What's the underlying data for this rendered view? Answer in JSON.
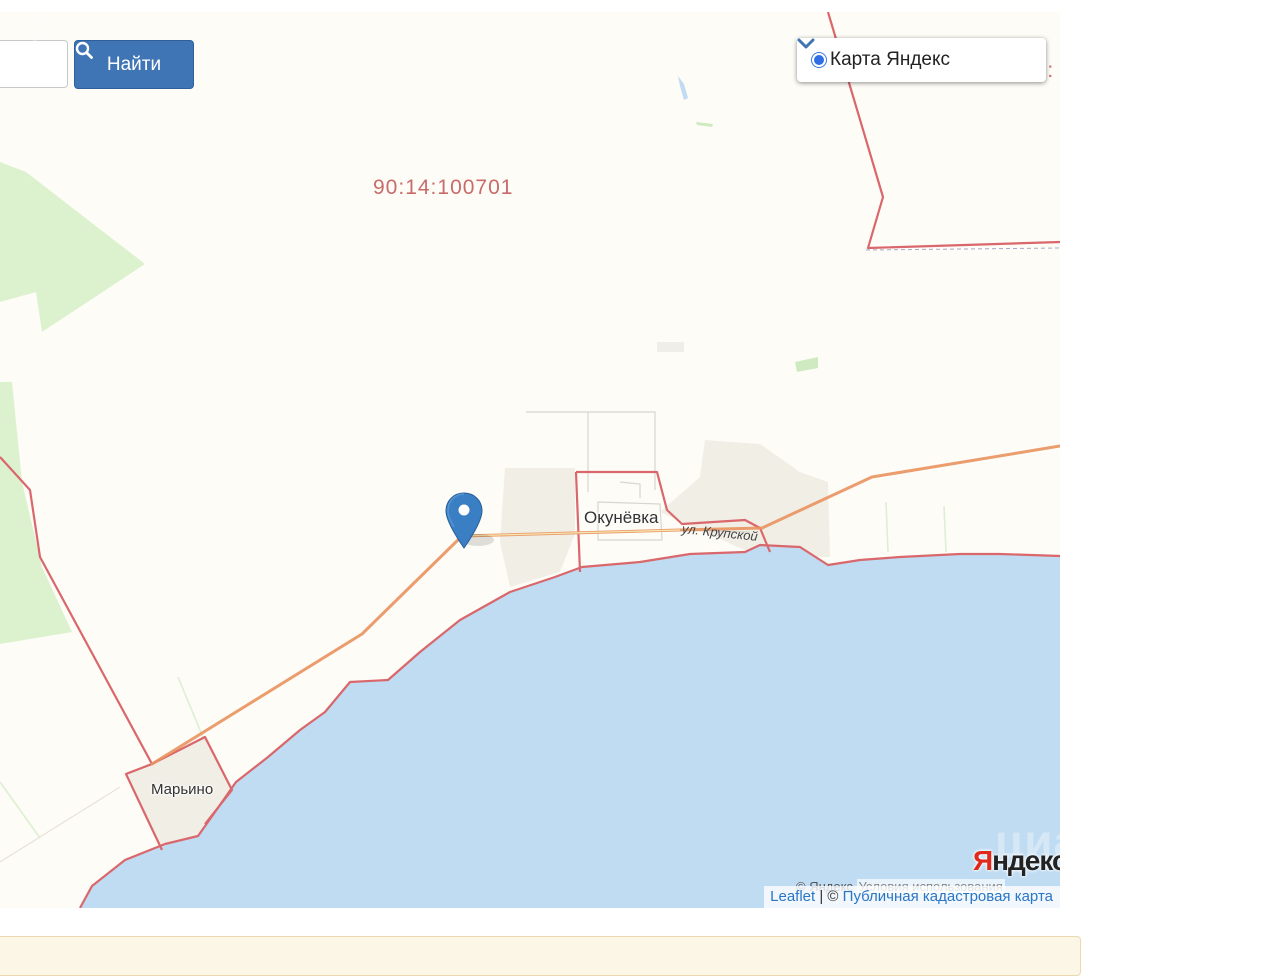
{
  "search": {
    "input_value": "",
    "button_label": "Найти"
  },
  "layer_switcher": {
    "selected": "Карта Яндекс"
  },
  "map": {
    "cadastral_labels": [
      "90:14:100701",
      "90:"
    ],
    "places": {
      "okunevka": "Окунёвка",
      "marino": "Марьино",
      "street": "ул. Крупской"
    },
    "colors": {
      "land": "#fdfcf6",
      "water": "#c0dcf2",
      "boundary": "#d9676b",
      "road": "#e9925e",
      "forest": "#dcf2cf",
      "marker": "#3a7fc4"
    }
  },
  "yandex": {
    "logo": "Яндекс",
    "logo_first": "Я",
    "logo_rest": "ндекс",
    "copyright": "© Яндекс",
    "terms": "Условия использования"
  },
  "attribution": {
    "leaflet": "Leaflet",
    "separator": " | © ",
    "cadastral": "Публичная кадастровая карта"
  },
  "watermark": {
    "text": "циан"
  }
}
